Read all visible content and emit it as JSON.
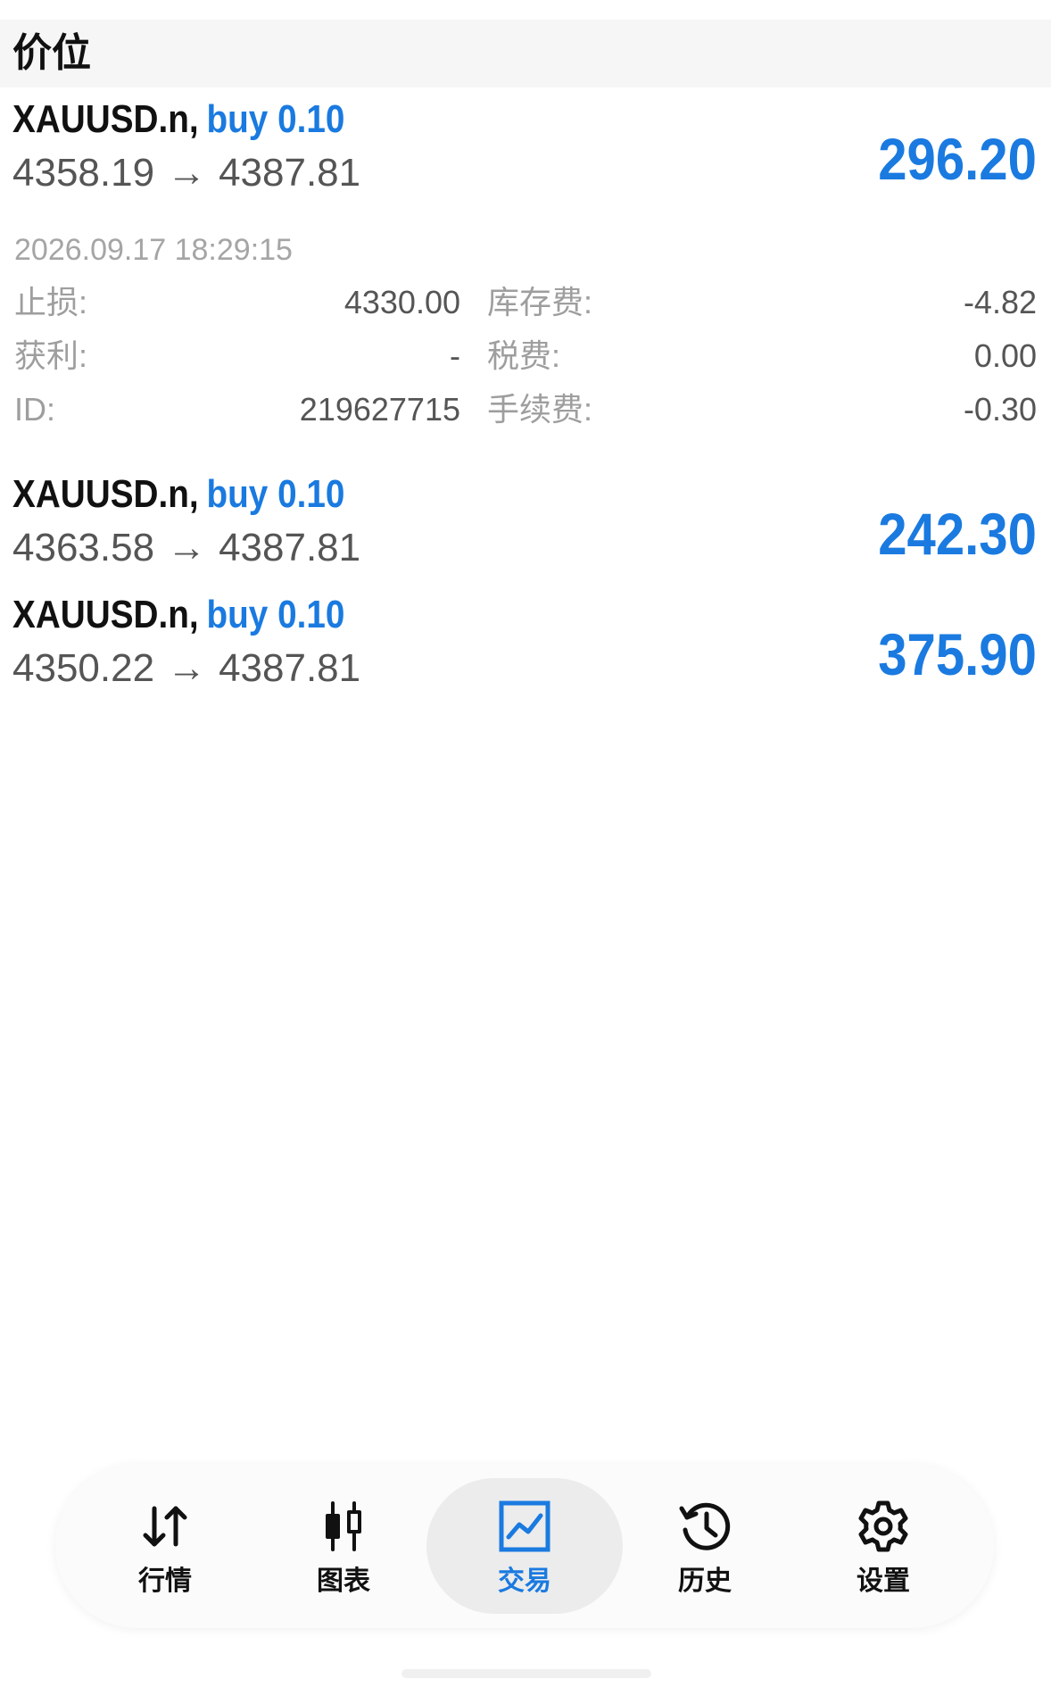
{
  "section": {
    "title": "价位"
  },
  "positions": [
    {
      "symbol": "XAUUSD.n",
      "separator": ",",
      "direction": "buy 0.10",
      "open_price": "4358.19",
      "arrow": "→",
      "current_price": "4387.81",
      "profit": "296.20",
      "expanded": true,
      "time": "2026.09.17 18:29:15",
      "details": {
        "stop_loss_label": "止损:",
        "stop_loss_value": "4330.00",
        "swap_label": "库存费:",
        "swap_value": "-4.82",
        "take_profit_label": "获利:",
        "take_profit_value": "-",
        "tax_label": "税费:",
        "tax_value": "0.00",
        "id_label": "ID:",
        "id_value": "219627715",
        "commission_label": "手续费:",
        "commission_value": "-0.30"
      }
    },
    {
      "symbol": "XAUUSD.n",
      "separator": ",",
      "direction": "buy 0.10",
      "open_price": "4363.58",
      "arrow": "→",
      "current_price": "4387.81",
      "profit": "242.30",
      "expanded": false
    },
    {
      "symbol": "XAUUSD.n",
      "separator": ",",
      "direction": "buy 0.10",
      "open_price": "4350.22",
      "arrow": "→",
      "current_price": "4387.81",
      "profit": "375.90",
      "expanded": false
    }
  ],
  "nav": {
    "items": [
      {
        "label": "行情",
        "icon": "arrows-up-down-icon",
        "active": false
      },
      {
        "label": "图表",
        "icon": "candlestick-icon",
        "active": false
      },
      {
        "label": "交易",
        "icon": "trade-chart-icon",
        "active": true
      },
      {
        "label": "历史",
        "icon": "history-clock-icon",
        "active": false
      },
      {
        "label": "设置",
        "icon": "gear-icon",
        "active": false
      }
    ]
  },
  "colors": {
    "accent": "#1a7ae0",
    "header_bg": "#f6f6f6",
    "muted_text": "#9e9e9e",
    "price_text": "#555555"
  }
}
